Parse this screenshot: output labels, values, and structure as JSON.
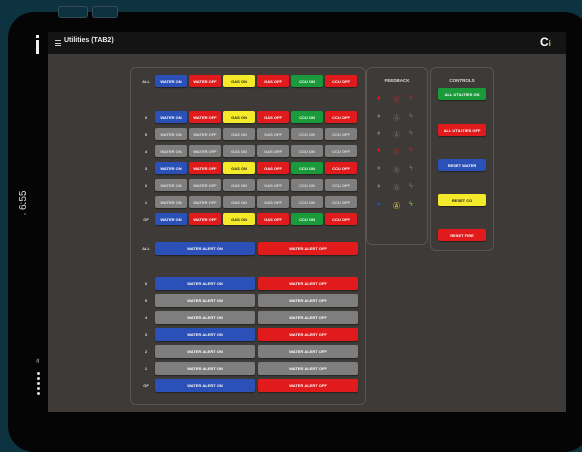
{
  "app": {
    "title": "Utilities (TAB2)",
    "logo_main": "C",
    "logo_accent": "i"
  },
  "status": {
    "time": "6:55"
  },
  "colors": {
    "blue": "#2b50b8",
    "red": "#e11b1b",
    "yellow": "#f5ea2a",
    "green": "#1a9a3a",
    "grey": "#7e7e7e"
  },
  "grid": {
    "rows": [
      {
        "label": "ALL",
        "states": [
          "blue",
          "red",
          "yellow",
          "red",
          "green",
          "red"
        ]
      },
      {
        "label": "6",
        "states": [
          "blue",
          "red",
          "yellow",
          "red",
          "green",
          "red"
        ]
      },
      {
        "label": "5",
        "states": [
          "grey",
          "grey",
          "grey",
          "grey",
          "grey",
          "grey"
        ]
      },
      {
        "label": "4",
        "states": [
          "grey",
          "grey",
          "grey",
          "grey",
          "grey",
          "grey"
        ]
      },
      {
        "label": "3",
        "states": [
          "blue",
          "red",
          "yellow",
          "red",
          "green",
          "red"
        ]
      },
      {
        "label": "2",
        "states": [
          "grey",
          "grey",
          "grey",
          "grey",
          "grey",
          "grey"
        ]
      },
      {
        "label": "1",
        "states": [
          "grey",
          "grey",
          "grey",
          "grey",
          "grey",
          "grey"
        ]
      },
      {
        "label": "GF",
        "states": [
          "blue",
          "red",
          "yellow",
          "red",
          "green",
          "red"
        ]
      }
    ],
    "buttons": [
      "WATER ON",
      "WATER OFF",
      "GAS ON",
      "GAS OFF",
      "CCU ON",
      "CCU OFF"
    ]
  },
  "alerts": {
    "on_label": "WATER ALERT ON",
    "off_label": "WATER ALERT OFF",
    "rows": [
      {
        "label": "ALL",
        "states": [
          "blue",
          "red"
        ]
      },
      {
        "label": "6",
        "states": [
          "blue",
          "red"
        ]
      },
      {
        "label": "5",
        "states": [
          "grey",
          "grey"
        ]
      },
      {
        "label": "4",
        "states": [
          "grey",
          "grey"
        ]
      },
      {
        "label": "3",
        "states": [
          "blue",
          "red"
        ]
      },
      {
        "label": "2",
        "states": [
          "grey",
          "grey"
        ]
      },
      {
        "label": "1",
        "states": [
          "grey",
          "grey"
        ]
      },
      {
        "label": "GF",
        "states": [
          "blue",
          "red"
        ]
      }
    ]
  },
  "feedback": {
    "header": "FEEDBACK",
    "rows": [
      {
        "icons": [
          "drop-red",
          "warning-red",
          "bolt-red"
        ]
      },
      {
        "icons": [
          "drop-grey",
          "warning-grey",
          "bolt-grey"
        ]
      },
      {
        "icons": [
          "drop-grey",
          "warning-grey",
          "bolt-grey"
        ]
      },
      {
        "icons": [
          "drop-red",
          "warning-red",
          "bolt-red"
        ]
      },
      {
        "icons": [
          "drop-grey",
          "warning-grey",
          "bolt-grey"
        ]
      },
      {
        "icons": [
          "drop-grey",
          "warning-grey",
          "bolt-grey"
        ]
      },
      {
        "icons": [
          "drop-blue",
          "warning-yellow",
          "bolt-green"
        ]
      }
    ]
  },
  "controls": {
    "header": "CONTROLS",
    "buttons": [
      {
        "label": "ALL UTILITIES ON",
        "color": "green"
      },
      {
        "label": "ALL UTILITIES OFF",
        "color": "red"
      },
      {
        "label": "RESET WATER",
        "color": "blue"
      },
      {
        "label": "RESET CO",
        "color": "yellow"
      },
      {
        "label": "RESET FIRE",
        "color": "red"
      }
    ]
  }
}
